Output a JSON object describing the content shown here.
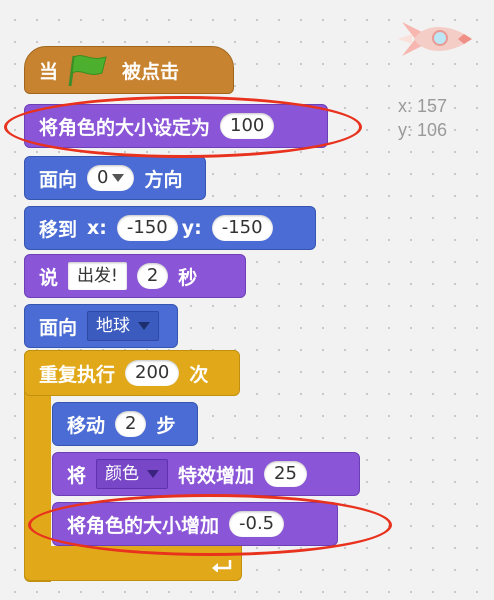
{
  "hat": {
    "when": "当",
    "flag_icon": "green-flag-icon",
    "clicked": "被点击"
  },
  "set_size": {
    "label": "将角色的大小设定为",
    "value": "100"
  },
  "point_dir": {
    "label_a": "面向",
    "value": "0",
    "label_b": "方向"
  },
  "goto_xy": {
    "label": "移到",
    "x_label": "x:",
    "x": "-150",
    "y_label": "y:",
    "y": "-150"
  },
  "say": {
    "label": "说",
    "message": "出发!",
    "secs": "2",
    "unit": "秒"
  },
  "point_toward": {
    "label": "面向",
    "target": "地球"
  },
  "repeat": {
    "label_a": "重复执行",
    "times": "200",
    "label_b": "次"
  },
  "move": {
    "label_a": "移动",
    "steps": "2",
    "label_b": "步"
  },
  "effect": {
    "label_a": "将",
    "effect": "颜色",
    "label_b": "特效增加",
    "amount": "25"
  },
  "change_size": {
    "label": "将角色的大小增加",
    "amount": "-0.5"
  },
  "sprite_info": {
    "x_label": "x:",
    "x": "157",
    "y_label": "y:",
    "y": "106"
  },
  "colors": {
    "events": "#c88330",
    "looks": "#8a55d7",
    "motion": "#4a6cd4",
    "control": "#e1a91a",
    "highlight": "#e8321d"
  }
}
